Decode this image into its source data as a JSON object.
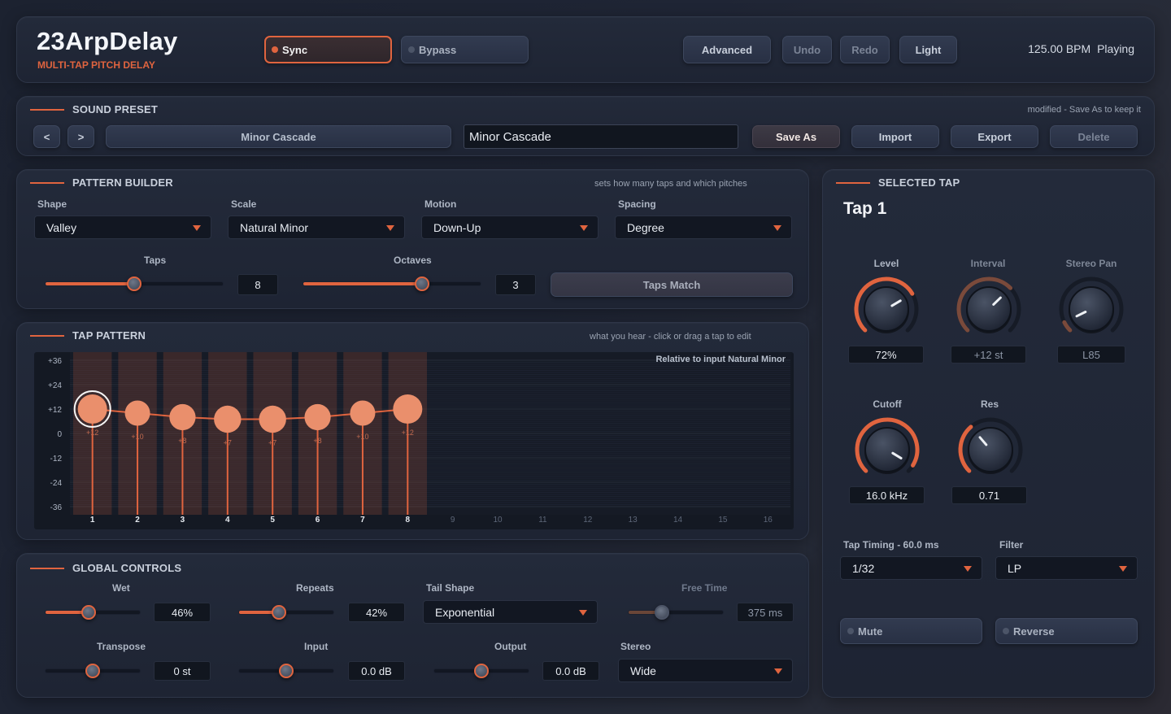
{
  "header": {
    "app_name": "23ArpDelay",
    "subtitle": "MULTI-TAP PITCH DELAY",
    "sync_label": "Sync",
    "bypass_label": "Bypass",
    "advanced_label": "Advanced",
    "undo_label": "Undo",
    "redo_label": "Redo",
    "light_label": "Light",
    "bpm": "125.00 BPM",
    "status": "Playing"
  },
  "preset": {
    "title": "SOUND PRESET",
    "hint": "modified - Save As to keep it",
    "prev_label": "<",
    "next_label": ">",
    "current": "Minor Cascade",
    "name_value": "Minor Cascade",
    "save_as": "Save As",
    "import": "Import",
    "export": "Export",
    "delete": "Delete"
  },
  "pattern_builder": {
    "title": "PATTERN BUILDER",
    "hint": "sets how many taps and which pitches",
    "shape_label": "Shape",
    "shape_value": "Valley",
    "scale_label": "Scale",
    "scale_value": "Natural Minor",
    "motion_label": "Motion",
    "motion_value": "Down-Up",
    "spacing_label": "Spacing",
    "spacing_value": "Degree",
    "taps_label": "Taps",
    "taps_value": "8",
    "taps_fraction": 0.5,
    "octaves_label": "Octaves",
    "octaves_value": "3",
    "octaves_fraction": 0.67,
    "taps_match": "Taps Match"
  },
  "tap_pattern": {
    "title": "TAP PATTERN",
    "hint": "what you hear - click or drag a tap to edit",
    "caption_prefix": "Relative to input",
    "caption_scale": "Natural Minor",
    "y_ticks": [
      "+36",
      "+24",
      "+12",
      "0",
      "-12",
      "-24",
      "-36"
    ],
    "columns": [
      "1",
      "2",
      "3",
      "4",
      "5",
      "6",
      "7",
      "8",
      "9",
      "10",
      "11",
      "12",
      "13",
      "14",
      "15",
      "16"
    ],
    "active_count": 8,
    "taps": [
      {
        "col": 1,
        "value": 12,
        "label": "+12"
      },
      {
        "col": 2,
        "value": 10,
        "label": "+10"
      },
      {
        "col": 3,
        "value": 8,
        "label": "+8"
      },
      {
        "col": 4,
        "value": 7,
        "label": "+7"
      },
      {
        "col": 5,
        "value": 7,
        "label": "+7"
      },
      {
        "col": 6,
        "value": 8,
        "label": "+8"
      },
      {
        "col": 7,
        "value": 10,
        "label": "+10"
      },
      {
        "col": 8,
        "value": 12,
        "label": "+12"
      }
    ],
    "selected": 1
  },
  "global": {
    "title": "GLOBAL CONTROLS",
    "wet_label": "Wet",
    "wet_value": "46%",
    "wet_fraction": 0.46,
    "repeats_label": "Repeats",
    "repeats_value": "42%",
    "repeats_fraction": 0.42,
    "tail_label": "Tail Shape",
    "tail_value": "Exponential",
    "freetime_label": "Free Time",
    "freetime_value": "375 ms",
    "freetime_fraction": 0.35,
    "transpose_label": "Transpose",
    "transpose_value": "0 st",
    "transpose_fraction": 0.5,
    "input_label": "Input",
    "input_value": "0.0 dB",
    "input_fraction": 0.5,
    "output_label": "Output",
    "output_value": "0.0 dB",
    "output_fraction": 0.5,
    "stereo_label": "Stereo",
    "stereo_value": "Wide"
  },
  "selected_tap": {
    "title": "SELECTED TAP",
    "name": "Tap 1",
    "level_label": "Level",
    "level_value": "72%",
    "level_fraction": 0.72,
    "interval_label": "Interval",
    "interval_value": "+12 st",
    "interval_fraction": 0.67,
    "pan_label": "Stereo Pan",
    "pan_value": "L85",
    "pan_fraction": 0.07,
    "cutoff_label": "Cutoff",
    "cutoff_value": "16.0 kHz",
    "cutoff_fraction": 0.95,
    "res_label": "Res",
    "res_value": "0.71",
    "res_fraction": 0.35,
    "timing_label": "Tap Timing - 60.0 ms",
    "timing_value": "1/32",
    "filter_label": "Filter",
    "filter_value": "LP",
    "mute_label": "Mute",
    "reverse_label": "Reverse"
  },
  "colors": {
    "accent": "#e0643f",
    "panel": "#222938",
    "background": "#1d2331"
  }
}
